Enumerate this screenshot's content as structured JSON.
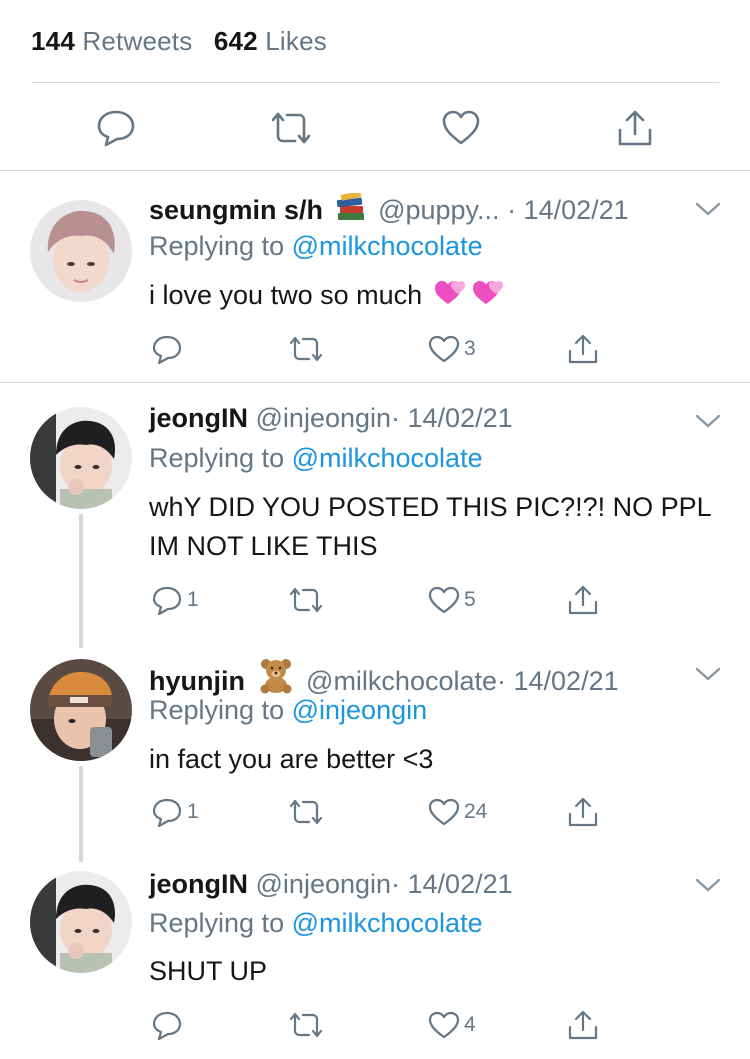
{
  "stats": {
    "retweets_count": "144",
    "retweets_label": "Retweets",
    "likes_count": "642",
    "likes_label": "Likes"
  },
  "main_actions": [
    "reply-icon",
    "retweet-icon",
    "like-icon",
    "share-icon"
  ],
  "colors": {
    "link": "#1b95e0",
    "secondary": "#657786",
    "text": "#14171a",
    "divider": "#d6dadd"
  },
  "tweets": [
    {
      "name": "seungmin s/h",
      "emoji": "books",
      "handle": "@puppy...",
      "date": "· 14/02/21",
      "reply_prefix": "Replying to",
      "reply_to": "@milkchocolate",
      "text": "i love you two so much",
      "text_emoji": "two-hearts",
      "replies": "",
      "likes": "3"
    },
    {
      "name": "jeongIN",
      "emoji": "",
      "handle": "@injeongin",
      "date": "· 14/02/21",
      "reply_prefix": "Replying to",
      "reply_to": "@milkchocolate",
      "text": "whY DID YOU POSTED THIS PIC?!?! NO PPL IM NOT LIKE THIS",
      "replies": "1",
      "likes": "5"
    },
    {
      "name": "hyunjin",
      "emoji": "teddy-bear",
      "handle": "@milkchocolate",
      "date": "· 14/02/21",
      "reply_prefix": "Replying to",
      "reply_to": "@injeongin",
      "text": "in fact you are better <3",
      "replies": "1",
      "likes": "24"
    },
    {
      "name": "jeongIN",
      "emoji": "",
      "handle": "@injeongin",
      "date": "· 14/02/21",
      "reply_prefix": "Replying to",
      "reply_to": "@milkchocolate",
      "text": "SHUT UP",
      "replies": "",
      "likes": "4"
    }
  ]
}
